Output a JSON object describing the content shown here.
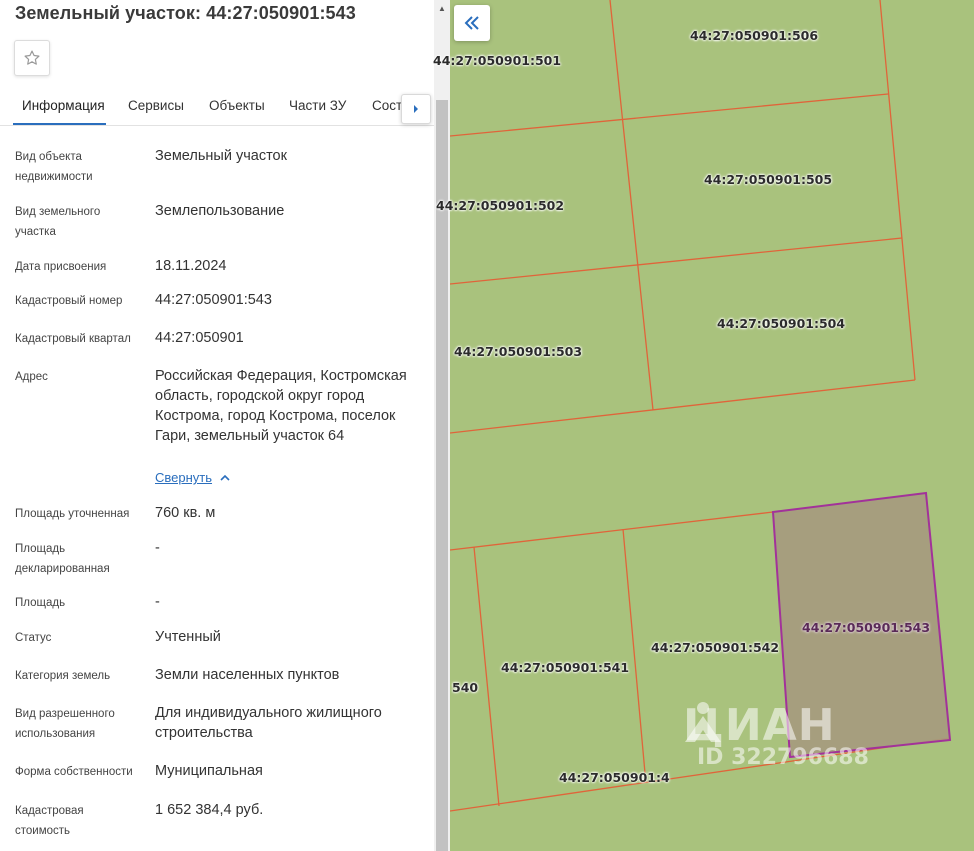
{
  "panel": {
    "title": "Земельный участок: 44:27:050901:543",
    "tabs": [
      {
        "label": "Информация",
        "active": true
      },
      {
        "label": "Сервисы",
        "active": false
      },
      {
        "label": "Объекты",
        "active": false
      },
      {
        "label": "Части ЗУ",
        "active": false
      },
      {
        "label": "Состав",
        "active": false
      }
    ],
    "collapse_link": "Свернуть",
    "fields": [
      {
        "label": "Вид объекта недвижимости",
        "value": "Земельный участок"
      },
      {
        "label": "Вид земельного участка",
        "value": "Землепользование"
      },
      {
        "label": "Дата присвоения",
        "value": "18.11.2024"
      },
      {
        "label": "Кадастровый номер",
        "value": "44:27:050901:543"
      },
      {
        "label": "Кадастровый квартал",
        "value": "44:27:050901"
      },
      {
        "label": "Адрес",
        "value": "Российская Федерация, Костромская область, городской округ город Кострома, город Кострома, поселок Гари, земельный участок 64"
      },
      {
        "label": "Площадь уточненная",
        "value": "760 кв. м"
      },
      {
        "label": "Площадь декларированная",
        "value": "-"
      },
      {
        "label": "Площадь",
        "value": "-"
      },
      {
        "label": "Статус",
        "value": "Учтенный"
      },
      {
        "label": "Категория земель",
        "value": "Земли населенных пунктов"
      },
      {
        "label": "Вид разрешенного использования",
        "value": "Для индивидуального жилищного строительства"
      },
      {
        "label": "Форма собственности",
        "value": "Муниципальная"
      },
      {
        "label": "Кадастровая стоимость",
        "value": "1 652 384,4 руб."
      }
    ]
  },
  "map": {
    "parcels": [
      {
        "label": "44:27:050901:506",
        "selected": false
      },
      {
        "label": "44:27:050901:501",
        "selected": false
      },
      {
        "label": "44:27:050901:505",
        "selected": false
      },
      {
        "label": "44:27:050901:502",
        "selected": false
      },
      {
        "label": "44:27:050901:504",
        "selected": false
      },
      {
        "label": "44:27:050901:503",
        "selected": false
      },
      {
        "label": "44:27:050901:543",
        "selected": true
      },
      {
        "label": "44:27:050901:542",
        "selected": false
      },
      {
        "label": "44:27:050901:541",
        "selected": false
      },
      {
        "label": "540",
        "selected": false
      },
      {
        "label": "44:27:050901:4",
        "selected": false
      }
    ],
    "watermark": {
      "brand": "ЦИАН",
      "id": "ID 322796688"
    }
  },
  "colors": {
    "map_bg": "#a9c27d",
    "parcel_border": "#e0643a",
    "selected_border": "#a2329a",
    "selected_fill": "#a59a7e",
    "link": "#2a6ebd"
  },
  "icons": [
    "star-icon",
    "chevron-right-icon",
    "chevron-up-icon",
    "double-chevron-left-icon",
    "cian-logo-icon"
  ]
}
